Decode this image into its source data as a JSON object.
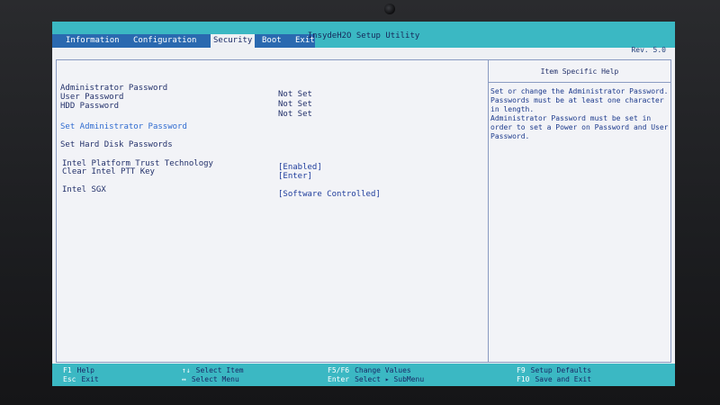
{
  "utility": {
    "title": "InsydeH2O Setup Utility",
    "revision": "Rev. 5.0"
  },
  "tabs": [
    {
      "label": "Information"
    },
    {
      "label": "Configuration"
    },
    {
      "label": "Security",
      "selected": true
    },
    {
      "label": "Boot"
    },
    {
      "label": "Exit"
    }
  ],
  "settings": {
    "admin_password": {
      "label": "Administrator Password",
      "value": "Not Set"
    },
    "user_password": {
      "label": "User Password",
      "value": "Not Set"
    },
    "hdd_password": {
      "label": "HDD Password",
      "value": "Not Set"
    },
    "set_admin_password": {
      "label": "Set Administrator Password"
    },
    "set_hdd_passwords": {
      "label": "Set Hard Disk Passwords"
    },
    "intel_ptt": {
      "label": "Intel Platform Trust Technology",
      "value": "[Enabled]"
    },
    "clear_ptt_key": {
      "label": "Clear Intel PTT Key",
      "value": "[Enter]"
    },
    "intel_sgx": {
      "label": "Intel SGX",
      "value": "[Software Controlled]"
    }
  },
  "help": {
    "title": "Item Specific Help",
    "text": "Set or change the Administrator Password.\n Passwords must be at least one character\n in length.\nAdministrator Password must be set in\norder to set a Power on Password and User\n Password."
  },
  "footer": {
    "f1": {
      "key": "F1",
      "desc": "Help"
    },
    "esc": {
      "key": "Esc",
      "desc": "Exit"
    },
    "updown": {
      "key": "↑↓",
      "desc": "Select Item"
    },
    "leftright": {
      "key": "↔",
      "desc": "Select Menu"
    },
    "f5f6": {
      "key": "F5/F6",
      "desc": "Change Values"
    },
    "enter": {
      "key": "Enter",
      "desc": "Select ▸ SubMenu"
    },
    "f9": {
      "key": "F9",
      "desc": "Setup Defaults"
    },
    "f10": {
      "key": "F10",
      "desc": "Save and Exit"
    }
  },
  "colors": {
    "bar": "#3bb8c3",
    "screen_bg": "#eef0f4",
    "text": "#22306a",
    "highlight": "#2f6bd0"
  }
}
